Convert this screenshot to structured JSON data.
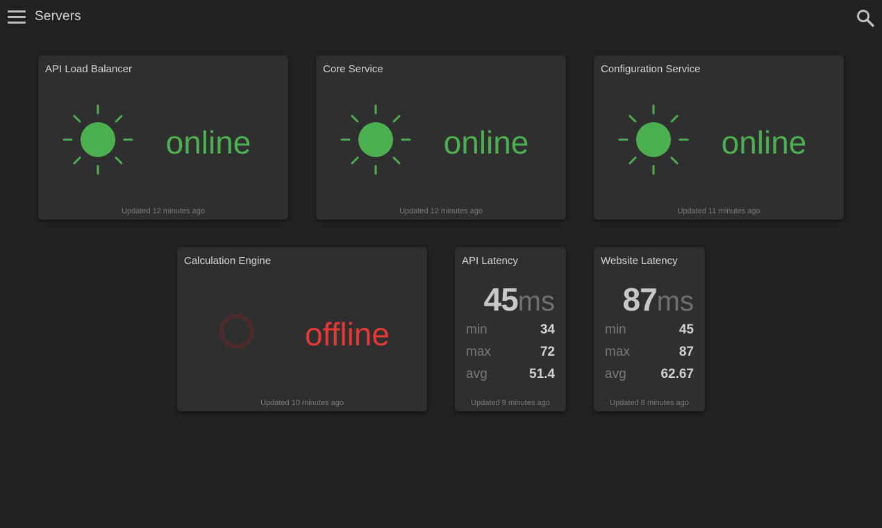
{
  "header": {
    "title": "Servers",
    "menu_icon": "hamburger-menu-icon",
    "search_icon": "search-icon"
  },
  "colors": {
    "background": "#212121",
    "tile": "#2f2f2f",
    "online": "#4caf50",
    "offline": "#e53935",
    "offline_ring": "#4d2b2b"
  },
  "status_tiles": [
    {
      "title": "API Load Balancer",
      "status": "online",
      "icon": "sun-icon",
      "updated": "Updated 12 minutes ago"
    },
    {
      "title": "Core Service",
      "status": "online",
      "icon": "sun-icon",
      "updated": "Updated 12 minutes ago"
    },
    {
      "title": "Configuration Service",
      "status": "online",
      "icon": "sun-icon",
      "updated": "Updated 11 minutes ago"
    },
    {
      "title": "Calculation Engine",
      "status": "offline",
      "icon": "ring-icon",
      "updated": "Updated 10 minutes ago"
    }
  ],
  "latency_tiles": [
    {
      "title": "API Latency",
      "value": "45",
      "unit": "ms",
      "stats": [
        {
          "label": "min",
          "value": "34"
        },
        {
          "label": "max",
          "value": "72"
        },
        {
          "label": "avg",
          "value": "51.4"
        }
      ],
      "updated": "Updated 9 minutes ago"
    },
    {
      "title": "Website Latency",
      "value": "87",
      "unit": "ms",
      "stats": [
        {
          "label": "min",
          "value": "45"
        },
        {
          "label": "max",
          "value": "87"
        },
        {
          "label": "avg",
          "value": "62.67"
        }
      ],
      "updated": "Updated 8 minutes ago"
    }
  ]
}
